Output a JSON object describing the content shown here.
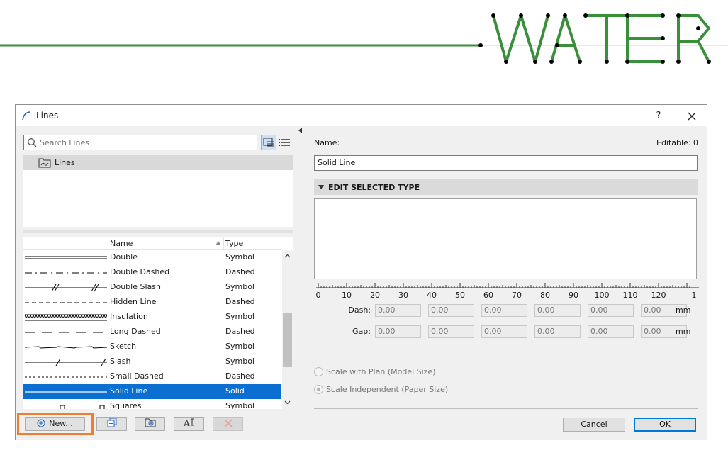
{
  "banner": {
    "logo_text": "WATER",
    "accent_color": "#3a8f3a"
  },
  "dialog": {
    "title": "Lines",
    "help_label": "?",
    "close_icon": "close-icon"
  },
  "search": {
    "placeholder": "Search Lines",
    "value": ""
  },
  "tree": {
    "label": "Lines"
  },
  "list": {
    "columns": {
      "name": "Name",
      "type": "Type"
    },
    "rows": [
      {
        "name": "Double",
        "type": "Symbol",
        "preview": "double"
      },
      {
        "name": "Double Dashed",
        "type": "Dashed",
        "preview": "dashdot"
      },
      {
        "name": "Double Slash",
        "type": "Symbol",
        "preview": "doubleslash"
      },
      {
        "name": "Hidden Line",
        "type": "Dashed",
        "preview": "hidden"
      },
      {
        "name": "Insulation",
        "type": "Symbol",
        "preview": "insulation"
      },
      {
        "name": "Long Dashed",
        "type": "Dashed",
        "preview": "longdash"
      },
      {
        "name": "Sketch",
        "type": "Symbol",
        "preview": "sketch"
      },
      {
        "name": "Slash",
        "type": "Symbol",
        "preview": "slash"
      },
      {
        "name": "Small Dashed",
        "type": "Dashed",
        "preview": "smalldash"
      },
      {
        "name": "Solid Line",
        "type": "Solid",
        "preview": "solid",
        "selected": true
      },
      {
        "name": "Squares",
        "type": "Symbol",
        "preview": "squares"
      }
    ]
  },
  "buttons": {
    "new_label": "New...",
    "cancel_label": "Cancel",
    "ok_label": "OK"
  },
  "editor": {
    "name_label": "Name:",
    "editable_label": "Editable: 0",
    "name_value": "Solid Line",
    "section_title": "EDIT SELECTED TYPE",
    "ruler_ticks": [
      "0",
      "10",
      "20",
      "30",
      "40",
      "50",
      "60",
      "70",
      "80",
      "90",
      "100",
      "110",
      "120",
      "1"
    ],
    "dash_label": "Dash:",
    "gap_label": "Gap:",
    "dash_values": [
      "0.00",
      "0.00",
      "0.00",
      "0.00",
      "0.00",
      "0.00"
    ],
    "gap_values": [
      "0.00",
      "0.00",
      "0.00",
      "0.00",
      "0.00",
      "0.00"
    ],
    "unit": "mm",
    "scale_model_label": "Scale with Plan (Model Size)",
    "scale_paper_label": "Scale Independent (Paper Size)",
    "scale_selected": "paper"
  },
  "colors": {
    "selection": "#0a6fd1",
    "highlight": "#ef7d2e"
  }
}
